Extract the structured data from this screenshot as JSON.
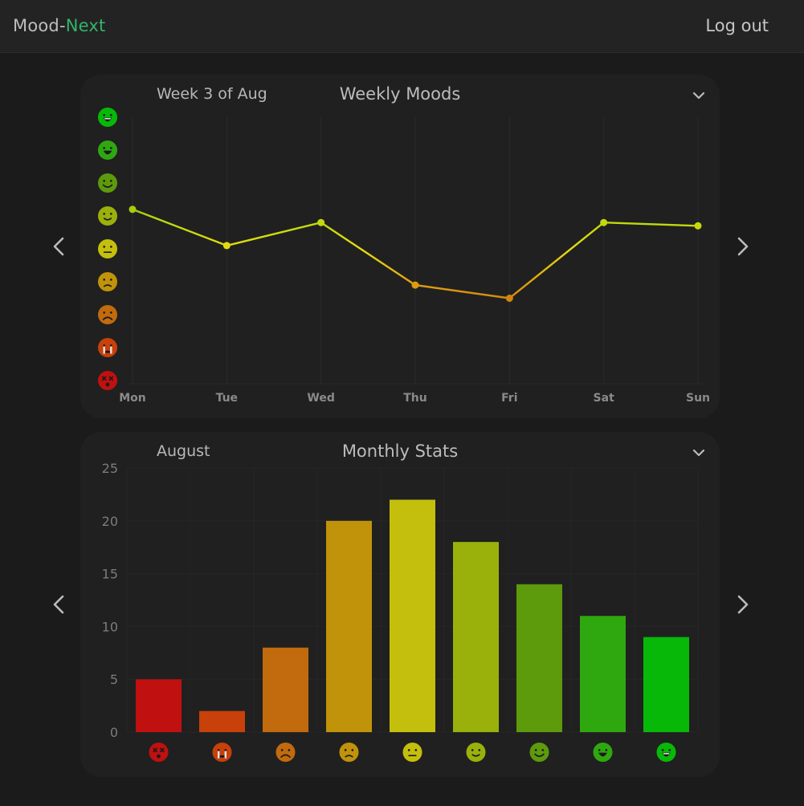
{
  "app": {
    "brand_prefix": "Mood-",
    "brand_suffix": "Next",
    "logout_label": "Log out",
    "accent_color": "#33b36b"
  },
  "weekly": {
    "title": "Weekly Moods",
    "period": "Week 3 of Aug",
    "prev_icon": "chevron-left-icon",
    "next_icon": "chevron-right-icon",
    "dropdown_icon": "chevron-down-icon"
  },
  "monthly": {
    "title": "Monthly Stats",
    "period": "August",
    "prev_icon": "chevron-left-icon",
    "next_icon": "chevron-right-icon",
    "dropdown_icon": "chevron-down-icon"
  },
  "moods": [
    {
      "icon": "dizzy-face-icon",
      "color": "#c01010"
    },
    {
      "icon": "crying-face-icon",
      "color": "#c8400a"
    },
    {
      "icon": "frowning-face-icon",
      "color": "#c26a0e"
    },
    {
      "icon": "sad-face-icon",
      "color": "#c0930a"
    },
    {
      "icon": "neutral-face-icon",
      "color": "#c4bf0c"
    },
    {
      "icon": "slight-smile-icon",
      "color": "#9ab10c"
    },
    {
      "icon": "smiling-face-icon",
      "color": "#5d9a0c"
    },
    {
      "icon": "grinning-face-icon",
      "color": "#2fa810"
    },
    {
      "icon": "beaming-face-icon",
      "color": "#08b808"
    }
  ],
  "chart_data": [
    {
      "type": "line",
      "title": "Weekly Moods",
      "categories": [
        "Mon",
        "Tue",
        "Wed",
        "Thu",
        "Fri",
        "Sat",
        "Sun"
      ],
      "values": [
        5.2,
        4.1,
        4.8,
        2.9,
        2.5,
        4.8,
        4.7
      ],
      "ylim": [
        0,
        8
      ],
      "y_axis": "mood icons (worst to best)"
    },
    {
      "type": "bar",
      "title": "Monthly Stats",
      "categories": [
        "dizzy",
        "crying",
        "frowning",
        "sad",
        "neutral",
        "slight-smile",
        "smiling",
        "grinning",
        "beaming"
      ],
      "values": [
        5,
        2,
        8,
        20,
        22,
        18,
        14,
        11,
        9
      ],
      "ylim": [
        0,
        25
      ],
      "yticks": [
        "0",
        "5",
        "10",
        "15",
        "20",
        "25"
      ]
    }
  ]
}
